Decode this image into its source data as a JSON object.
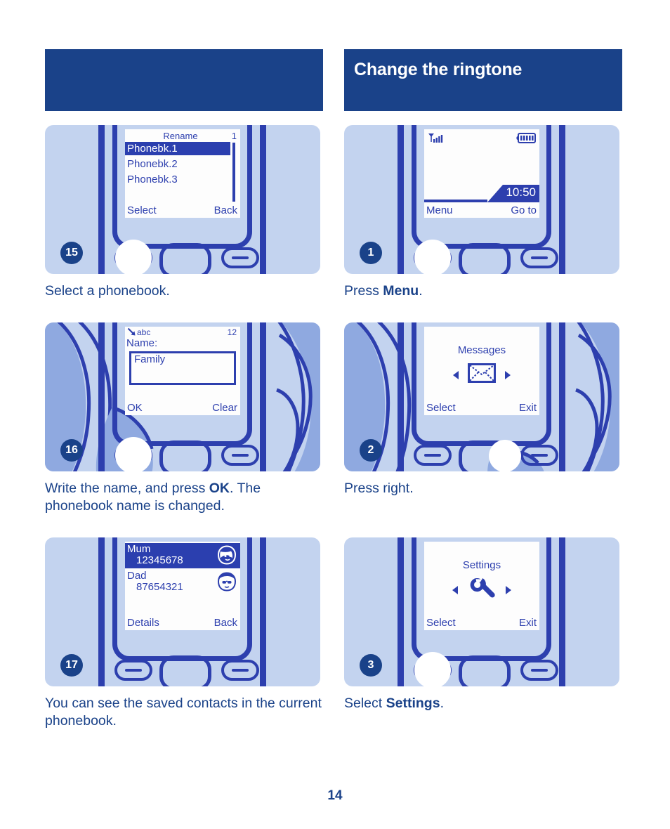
{
  "header": {
    "left_title": "",
    "right_title": "Change the ringtone"
  },
  "page_number": "14",
  "colors": {
    "brand_dark_blue": "#1a4289",
    "phone_blue": "#2d3fae",
    "panel_blue": "#c3d3ef",
    "hand_blue": "#8fa9e0",
    "screen_white": "#fdfdfd",
    "highlight_blue": "#2b3faf"
  },
  "steps": [
    {
      "number": "15",
      "column": "left",
      "caption_parts": [
        {
          "text": "Select a phonebook.",
          "bold": false
        }
      ],
      "screen": {
        "type": "list",
        "title": "Rename",
        "count": "1",
        "items": [
          {
            "label": "Phonebk.1",
            "selected": true
          },
          {
            "label": "Phonebk.2",
            "selected": false
          },
          {
            "label": "Phonebk.3",
            "selected": false
          }
        ],
        "softkey_left": "Select",
        "softkey_right": "Back"
      },
      "pressed_key": "left-softkey",
      "hand": false
    },
    {
      "number": "1",
      "column": "right",
      "caption_parts": [
        {
          "text": "Press ",
          "bold": false
        },
        {
          "text": "Menu",
          "bold": true
        },
        {
          "text": ".",
          "bold": false
        }
      ],
      "screen": {
        "type": "standby",
        "signal_icon": "signal-bars-icon",
        "battery_icon": "battery-full-icon",
        "time": "10:50",
        "softkey_left": "Menu",
        "softkey_right": "Go to"
      },
      "pressed_key": "left-softkey",
      "hand": false
    },
    {
      "number": "16",
      "column": "left",
      "caption_parts": [
        {
          "text": "Write the name, and press ",
          "bold": false
        },
        {
          "text": "OK",
          "bold": true
        },
        {
          "text": ". The phonebook name is changed.",
          "bold": false
        }
      ],
      "screen": {
        "type": "text-entry",
        "input_mode_icon": "abc-input-mode-icon",
        "input_mode": "abc",
        "count": "12",
        "label": "Name:",
        "value": "Family",
        "softkey_left": "OK",
        "softkey_right": "Clear"
      },
      "pressed_key": "left-softkey",
      "hand": true
    },
    {
      "number": "2",
      "column": "right",
      "caption_parts": [
        {
          "text": "Press right.",
          "bold": false
        }
      ],
      "screen": {
        "type": "menu-icon",
        "title": "Messages",
        "icon": "envelope-icon",
        "left_arrow_icon": "arrow-left-icon",
        "right_arrow_icon": "arrow-right-icon",
        "softkey_left": "Select",
        "softkey_right": "Exit"
      },
      "pressed_key": "nav-right",
      "hand": true
    },
    {
      "number": "17",
      "column": "left",
      "caption_parts": [
        {
          "text": "You can see the saved contacts in the current phonebook.",
          "bold": false
        }
      ],
      "screen": {
        "type": "contacts",
        "contacts": [
          {
            "name": "Mum",
            "number": "12345678",
            "avatar": "female-face-icon",
            "selected": true
          },
          {
            "name": "Dad",
            "number": "87654321",
            "avatar": "male-face-icon",
            "selected": false
          }
        ],
        "softkey_left": "Details",
        "softkey_right": "Back"
      },
      "pressed_key": "none",
      "hand": false
    },
    {
      "number": "3",
      "column": "right",
      "caption_parts": [
        {
          "text": "Select ",
          "bold": false
        },
        {
          "text": "Settings",
          "bold": true
        },
        {
          "text": ".",
          "bold": false
        }
      ],
      "screen": {
        "type": "menu-icon",
        "title": "Settings",
        "icon": "wrench-icon",
        "left_arrow_icon": "arrow-left-icon",
        "right_arrow_icon": "arrow-right-icon",
        "softkey_left": "Select",
        "softkey_right": "Exit"
      },
      "pressed_key": "left-softkey",
      "hand": false
    }
  ]
}
